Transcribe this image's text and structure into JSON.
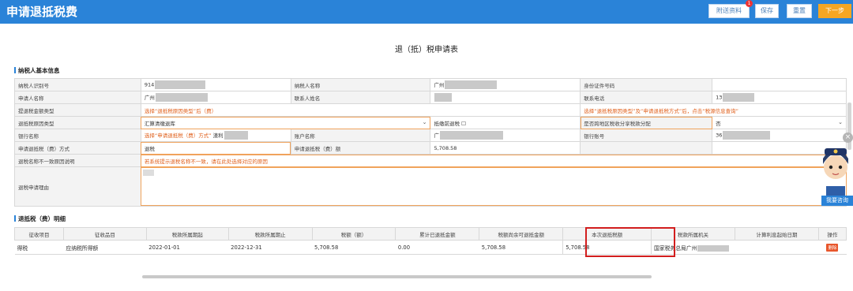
{
  "header": {
    "title": "申请退抵税费",
    "buttons": {
      "attach": "附送资料",
      "save": "保存",
      "reset": "重置",
      "next": "下一步"
    },
    "attach_badge": "1"
  },
  "form_title": "退（抵）税申请表",
  "taxpayer_section": {
    "heading": "纳税人基本信息",
    "labels": {
      "taxpayer_id": "纳税人识别号",
      "taxpayer_name": "纳税人名称",
      "id_type": "身份证件号码",
      "applicant": "申请人名称",
      "contact": "联系人姓名",
      "phone": "联系电话",
      "tax_type": "提退税金额类型",
      "refund_reason_type": "退抵税原因类型",
      "offset_tax": "抵缴前退税",
      "cross_region": "是否跨地区税收分享税款分配",
      "bank": "银行名称",
      "account_name": "账户名称",
      "account_no": "银行账号",
      "method": "申请退抵税（费）方式",
      "amount_label": "申请退抵税（费）额",
      "name_mismatch": "退税名称不一致原因说明",
      "reason": "退税申请理由"
    },
    "values": {
      "taxpayer_id": "914",
      "taxpayer_name": "广州",
      "applicant": "广州",
      "phone": "13",
      "refund_reason_type": "汇算清缴退库",
      "cross_region": "否",
      "bank": "渣利",
      "account_name": "广",
      "account_no": "36",
      "method": "退税",
      "amount": "5,708.58"
    },
    "hints": {
      "tax_type": "选择“退抵税原因类型”后（费）",
      "cross_region": "选择“退抵税原因类型”及“申请退抵税方式”后，点击“税源信息查询”",
      "bank": "选择“申请退抵税（费）方式”",
      "name_mismatch": "若系统提示退税名称不一致，请在此处选择对应的原因"
    }
  },
  "detail_section": {
    "heading": "退抵税（费）明细",
    "columns": [
      "征收项目",
      "征收品目",
      "税款所属期起",
      "税款所属期止",
      "税额（额）",
      "累计已退抵金额",
      "税额尚余可退抵金额",
      "本次退抵税额",
      "税款所属机关",
      "计算利息起始日期",
      "操作"
    ],
    "rows": [
      {
        "item": "得税",
        "sub_item": "应纳税所得额",
        "start": "2022-01-01",
        "end": "2022-12-31",
        "amount": "5,708.58",
        "refunded": "0.00",
        "remaining": "5,708.58",
        "this_refund": "5,708.58",
        "authority": "国家税务总局广州",
        "interest_start": "",
        "action": "删除"
      }
    ]
  },
  "assistant": {
    "label": "我要咨询"
  },
  "colors": {
    "header": "#2a83d8",
    "next_button": "#f5a623",
    "highlight_border": "#d21e1e",
    "hint": "#e0601c"
  }
}
